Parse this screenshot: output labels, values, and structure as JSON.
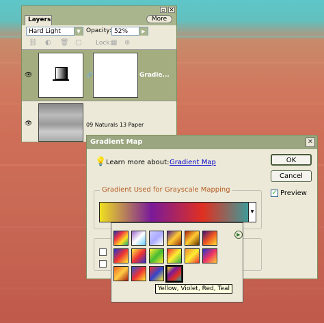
{
  "layers_panel": {
    "tab_label": "Layers",
    "more_button": "More",
    "blend_mode": "Hard Light",
    "opacity_label": "Opacity:",
    "opacity_value": "52%",
    "lock_label": "Lock:",
    "layers": [
      {
        "name": "Gradie...",
        "visible": true,
        "selected": true
      },
      {
        "name": "09 Naturals 13 Paper",
        "visible": true,
        "selected": false
      }
    ]
  },
  "gradient_map_dialog": {
    "title": "Gradient Map",
    "learn_more_label": "Learn more about:",
    "learn_more_link": "Gradient Map",
    "ok_button": "OK",
    "cancel_button": "Cancel",
    "preview_label": "Preview",
    "preview_checked": true,
    "group_label": "Gradient Used for Grayscale Mapping",
    "current_gradient_colors": [
      "#f0e020",
      "#7a1a9a",
      "#e03020",
      "#2aa8a8"
    ]
  },
  "gradient_picker": {
    "tooltip": "Yellow, Violet, Red, Teal",
    "presets": [
      [
        "#2233aa",
        "#ee3344",
        "#ffdd22",
        "#22aa66"
      ],
      [
        "#9966cc",
        "#ffffff",
        "#66ccff"
      ],
      [
        "#ccccff",
        "#aaaaff",
        "#ffffff"
      ],
      [
        "#552288",
        "#ffcc33",
        "#993311"
      ],
      [
        "#aa2211",
        "#ffcc33",
        "#663300"
      ],
      [
        "#441177",
        "#ee5522",
        "#ffdd33"
      ],
      [
        "#2233cc",
        "#ee3333",
        "#ffee33"
      ],
      [
        "#ffee44",
        "#ee3333",
        "#3333cc"
      ],
      [
        "#ffee33",
        "#44bb33",
        "#ffee33"
      ],
      [
        "#ee3333",
        "#ffee33",
        "#33aa44"
      ],
      [
        "#ee8833",
        "#ffee33",
        "#ee3333"
      ],
      [
        "#2233cc",
        "#ee3366",
        "#ffcc33"
      ],
      [
        "#ee6622",
        "#ffcc44",
        "#aa2211"
      ],
      [
        "#3355cc",
        "#ee3333",
        "#ffee33"
      ],
      [
        "#ee3333",
        "#3344cc",
        "#ffee33"
      ],
      [
        "#f0e020",
        "#7a1a9a",
        "#e03020",
        "#2aa8a8"
      ]
    ]
  }
}
